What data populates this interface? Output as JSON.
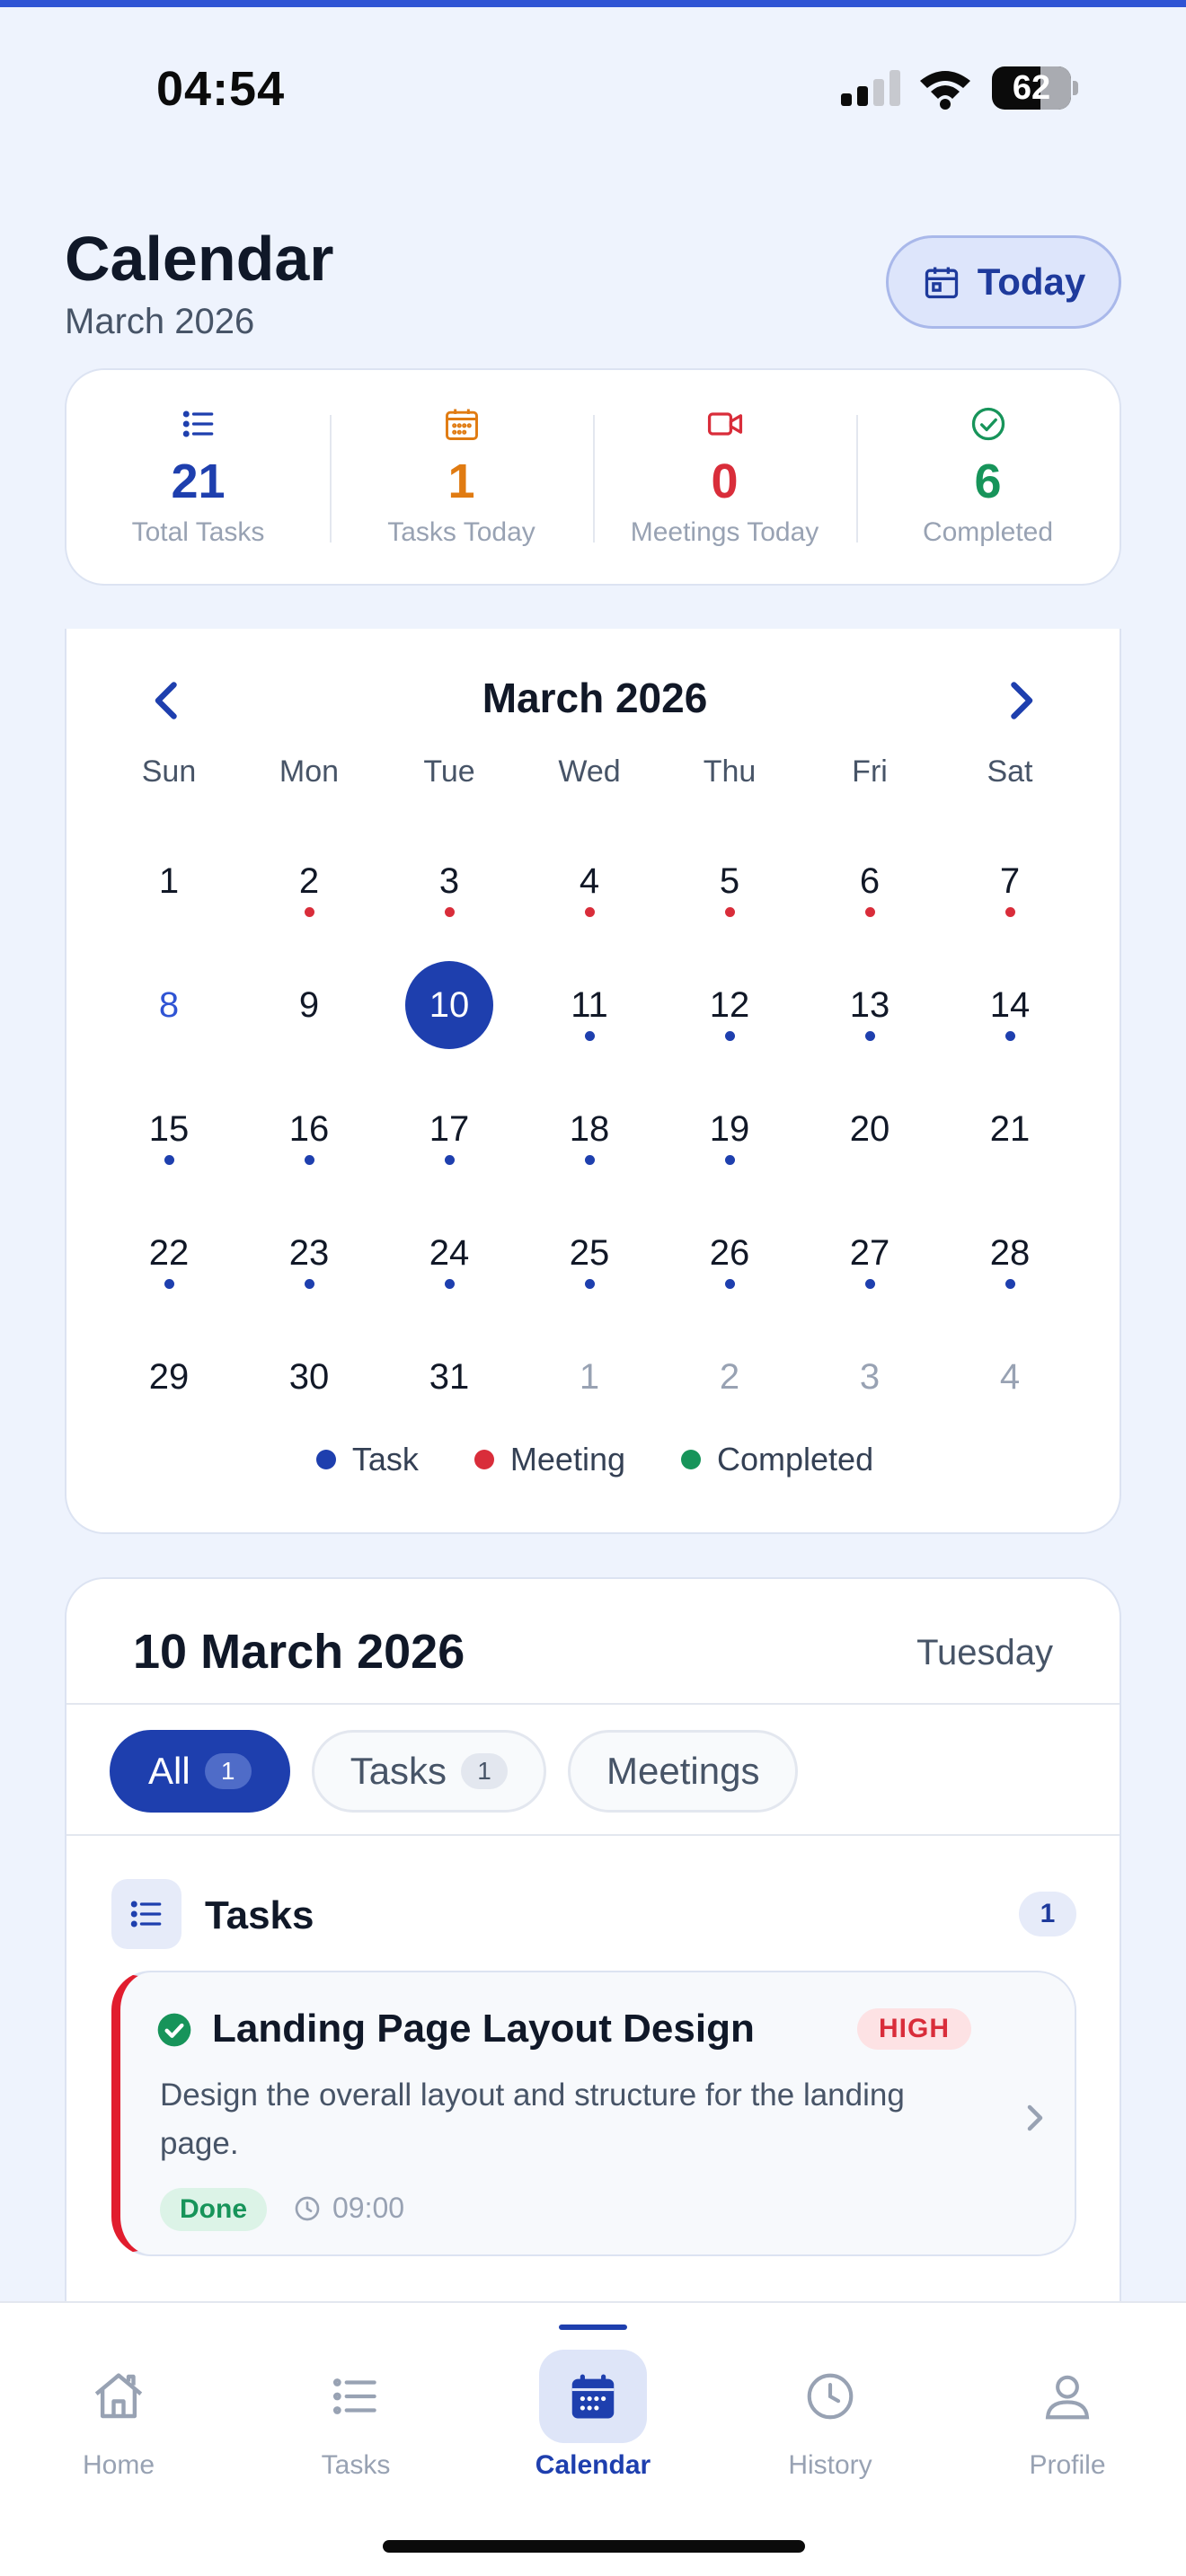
{
  "status_bar": {
    "time": "04:54",
    "battery": "62"
  },
  "header": {
    "title": "Calendar",
    "subtitle": "March 2026",
    "today_button": "Today"
  },
  "stats": [
    {
      "value": "21",
      "label": "Total Tasks",
      "icon": "list-icon",
      "color": "#1e3fae"
    },
    {
      "value": "1",
      "label": "Tasks Today",
      "icon": "calendar-icon",
      "color": "#e07b12"
    },
    {
      "value": "0",
      "label": "Meetings Today",
      "icon": "video-icon",
      "color": "#d92d3a"
    },
    {
      "value": "6",
      "label": "Completed",
      "icon": "check-circle-icon",
      "color": "#17945a"
    }
  ],
  "calendar": {
    "month_label": "March 2026",
    "weekdays": [
      "Sun",
      "Mon",
      "Tue",
      "Wed",
      "Thu",
      "Fri",
      "Sat"
    ],
    "days": [
      {
        "n": "1",
        "dot": null
      },
      {
        "n": "2",
        "dot": "meeting"
      },
      {
        "n": "3",
        "dot": "meeting"
      },
      {
        "n": "4",
        "dot": "meeting"
      },
      {
        "n": "5",
        "dot": "meeting"
      },
      {
        "n": "6",
        "dot": "meeting"
      },
      {
        "n": "7",
        "dot": "meeting"
      },
      {
        "n": "8",
        "dot": null,
        "blue": true
      },
      {
        "n": "9",
        "dot": null
      },
      {
        "n": "10",
        "dot": null,
        "selected": true
      },
      {
        "n": "11",
        "dot": "task"
      },
      {
        "n": "12",
        "dot": "task"
      },
      {
        "n": "13",
        "dot": "task"
      },
      {
        "n": "14",
        "dot": "task"
      },
      {
        "n": "15",
        "dot": "task"
      },
      {
        "n": "16",
        "dot": "task"
      },
      {
        "n": "17",
        "dot": "task"
      },
      {
        "n": "18",
        "dot": "task"
      },
      {
        "n": "19",
        "dot": "task"
      },
      {
        "n": "20",
        "dot": null
      },
      {
        "n": "21",
        "dot": null
      },
      {
        "n": "22",
        "dot": "task"
      },
      {
        "n": "23",
        "dot": "task"
      },
      {
        "n": "24",
        "dot": "task"
      },
      {
        "n": "25",
        "dot": "task"
      },
      {
        "n": "26",
        "dot": "task"
      },
      {
        "n": "27",
        "dot": "task"
      },
      {
        "n": "28",
        "dot": "task"
      },
      {
        "n": "29",
        "dot": null
      },
      {
        "n": "30",
        "dot": null
      },
      {
        "n": "31",
        "dot": null
      },
      {
        "n": "1",
        "dot": null,
        "muted": true
      },
      {
        "n": "2",
        "dot": null,
        "muted": true
      },
      {
        "n": "3",
        "dot": null,
        "muted": true
      },
      {
        "n": "4",
        "dot": null,
        "muted": true
      }
    ],
    "legend": [
      {
        "label": "Task",
        "color": "#1e3fae"
      },
      {
        "label": "Meeting",
        "color": "#d92d3a"
      },
      {
        "label": "Completed",
        "color": "#17945a"
      }
    ]
  },
  "colors": {
    "task": "#1e3fae",
    "meeting": "#d92d3a",
    "completed": "#17945a"
  },
  "detail": {
    "date": "10 March 2026",
    "weekday": "Tuesday",
    "filters": [
      {
        "label": "All",
        "count": "1",
        "active": true
      },
      {
        "label": "Tasks",
        "count": "1",
        "active": false
      },
      {
        "label": "Meetings",
        "count": null,
        "active": false
      }
    ],
    "section_title": "Tasks",
    "section_count": "1",
    "task": {
      "title": "Landing Page Layout Design",
      "priority": "HIGH",
      "description": "Design the overall layout and structure for the landing page.",
      "status": "Done",
      "time": "09:00"
    }
  },
  "nav": [
    {
      "label": "Home",
      "icon": "home-icon",
      "active": false
    },
    {
      "label": "Tasks",
      "icon": "list-icon",
      "active": false
    },
    {
      "label": "Calendar",
      "icon": "calendar-icon",
      "active": true
    },
    {
      "label": "History",
      "icon": "clock-icon",
      "active": false
    },
    {
      "label": "Profile",
      "icon": "user-icon",
      "active": false
    }
  ]
}
